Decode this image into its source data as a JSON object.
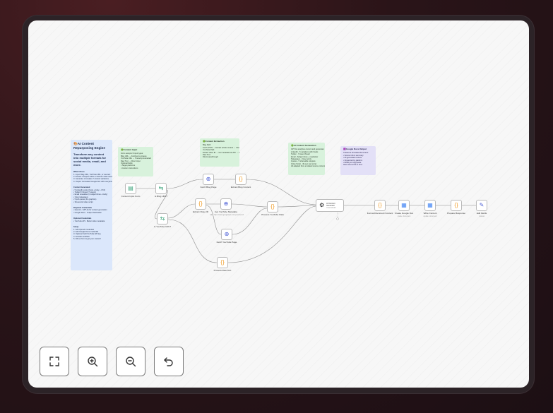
{
  "main_note": {
    "title": "🎨AI Content Repurposing Engine",
    "subtitle": "Transform any content into multiple formats for social media, email, and more.",
    "what_heading": "What it Does",
    "what_items": [
      "1. Input: Blog URL, YouTube URL, or raw text",
      "2. Extract: Scrapes article or fetches video transcript",
      "3. Generate: AI creates 7 content variations",
      "4. Output: Formatted Google Doc with everything"
    ],
    "generated_heading": "Content Generated",
    "generated_items": [
      "• 5 LinkedIn posts (hook + body + CTA)",
      "• Twitter/X thread (7 tweets)",
      "• Email newsletter (4 subject lines + body)",
      "• 3 key takeaways",
      "• 5 pull quotes (for graphics)",
      "• 30-second video script"
    ],
    "required_heading": "Required Credentials",
    "required_items": [
      "• OpenAI - GPT-4o for content generation",
      "• Google Docs - Output destination"
    ],
    "optional_heading": "Optional Credentials",
    "optional_items": [
      "• YouTube API - Better video metadata"
    ],
    "setup_heading": "Setup",
    "setup_items": [
      "1. Add OpenAI credential",
      "2. Add Google Docs credential",
      "3. Optional: Add YouTube API key",
      "4. Activate workflow",
      "5. Fill out form & get your content!"
    ]
  },
  "notes": {
    "content_input": {
      "title": "🟢Content Input",
      "lines": [
        "Form accepts 3 input types:",
        "",
        "Blog URL → Fetches & scrapes",
        "YouTube URL → Transcript extracted",
        "Raw Text → Direct input",
        "",
        "Optional fields:",
        "• Target platforms",
        "• Custom instructions"
      ]
    },
    "content_extraction": {
      "title": "🟢Content Extraction",
      "lines": [
        "Blog Path:",
        "Fetch HTML → Extract article content → Clean text",
        "",
        "YouTube Path:",
        "Extract video ID → Get metadata via API → Fetch transcript → Combine",
        "",
        "Raw Text:",
        "Direct passthrough"
      ]
    },
    "ai_generation": {
      "title": "🟢AI Content Generation",
      "lines": [
        "GPT-4o analyzes content and generates:",
        "",
        "LinkedIn - 5 variations with hooks",
        "Twitter - 7-tweet thread",
        "Email - Subject lines + newsletter",
        "Takeaways - 3 key points",
        "Quotes - 5 shareable snippets",
        "Video Script - 30-sec reel script",
        "",
        "All adapted from ai related source content"
      ]
    },
    "google_docs": {
      "title": "🟪Google Docs Output",
      "lines": [
        "Creates a formatted document:",
        "",
        "• Source info & summary",
        "• All generated content",
        "• Organized by platform",
        "• Ready to copy/paste",
        "",
        "Also returns link in form"
      ]
    }
  },
  "nodes": {
    "content_input_form": {
      "label": "Content Input Form",
      "icon": "form-icon"
    },
    "is_blog_url": {
      "label": "Is Blog URL?",
      "icon": "switch-icon"
    },
    "is_youtube_url": {
      "label": "Is YouTube URL?",
      "icon": "switch-icon"
    },
    "fetch_blog_page": {
      "label": "Fetch Blog Page",
      "icon": "globe-icon"
    },
    "extract_blog_content": {
      "label": "Extract Blog Content",
      "icon": "code-icon"
    },
    "extract_video_id": {
      "label": "Extract Video ID",
      "icon": "code-icon"
    },
    "get_youtube_metadata": {
      "label": "Get YouTube Metadata",
      "sublabel": "GET: https://www.googleapis.com/youtube/v3",
      "icon": "globe-icon"
    },
    "fetch_youtube_page": {
      "label": "Fetch YouTube Page",
      "icon": "globe-icon"
    },
    "process_youtube_data": {
      "label": "Process YouTube Data",
      "icon": "code-icon"
    },
    "process_raw_text": {
      "label": "Process Raw Text",
      "icon": "code-icon"
    },
    "ai_content_generator": {
      "label": "AI Content Generator",
      "sublabel": "Chat Model",
      "icon": "openai-icon"
    },
    "format_document_content": {
      "label": "Format Document Content",
      "icon": "code-icon"
    },
    "create_google_doc": {
      "label": "Create Google Doc",
      "sublabel": "create: document",
      "icon": "google-docs-icon"
    },
    "write_content": {
      "label": "Write Content",
      "sublabel": "update: document",
      "icon": "google-docs-icon"
    },
    "prepare_response": {
      "label": "Prepare Response",
      "icon": "code-icon"
    },
    "edit_fields": {
      "label": "Edit Fields",
      "sublabel": "manual",
      "icon": "pencil-icon"
    }
  },
  "controls": {
    "fit_view": {
      "icon": "fullscreen-icon"
    },
    "zoom_in": {
      "icon": "zoom-in-icon"
    },
    "zoom_out": {
      "icon": "zoom-out-icon"
    },
    "undo": {
      "icon": "undo-icon"
    }
  },
  "colors": {
    "connector": "#8d8d8d",
    "code_icon": "#f0a030",
    "switch_icon": "#3aa37a",
    "globe_icon": "#4c5fd6",
    "docs_icon": "#4285f4"
  }
}
